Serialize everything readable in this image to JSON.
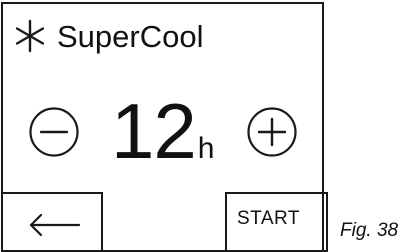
{
  "panel": {
    "mode": {
      "icon": "snowflake-asterisk-icon",
      "label": "SuperCool"
    },
    "timer": {
      "value": "12",
      "unit": "h",
      "decrease_icon": "minus-circle-icon",
      "increase_icon": "plus-circle-icon"
    },
    "buttons": {
      "back_icon": "arrow-left-icon",
      "start_label": "START"
    }
  },
  "figure_label": "Fig. 38"
}
